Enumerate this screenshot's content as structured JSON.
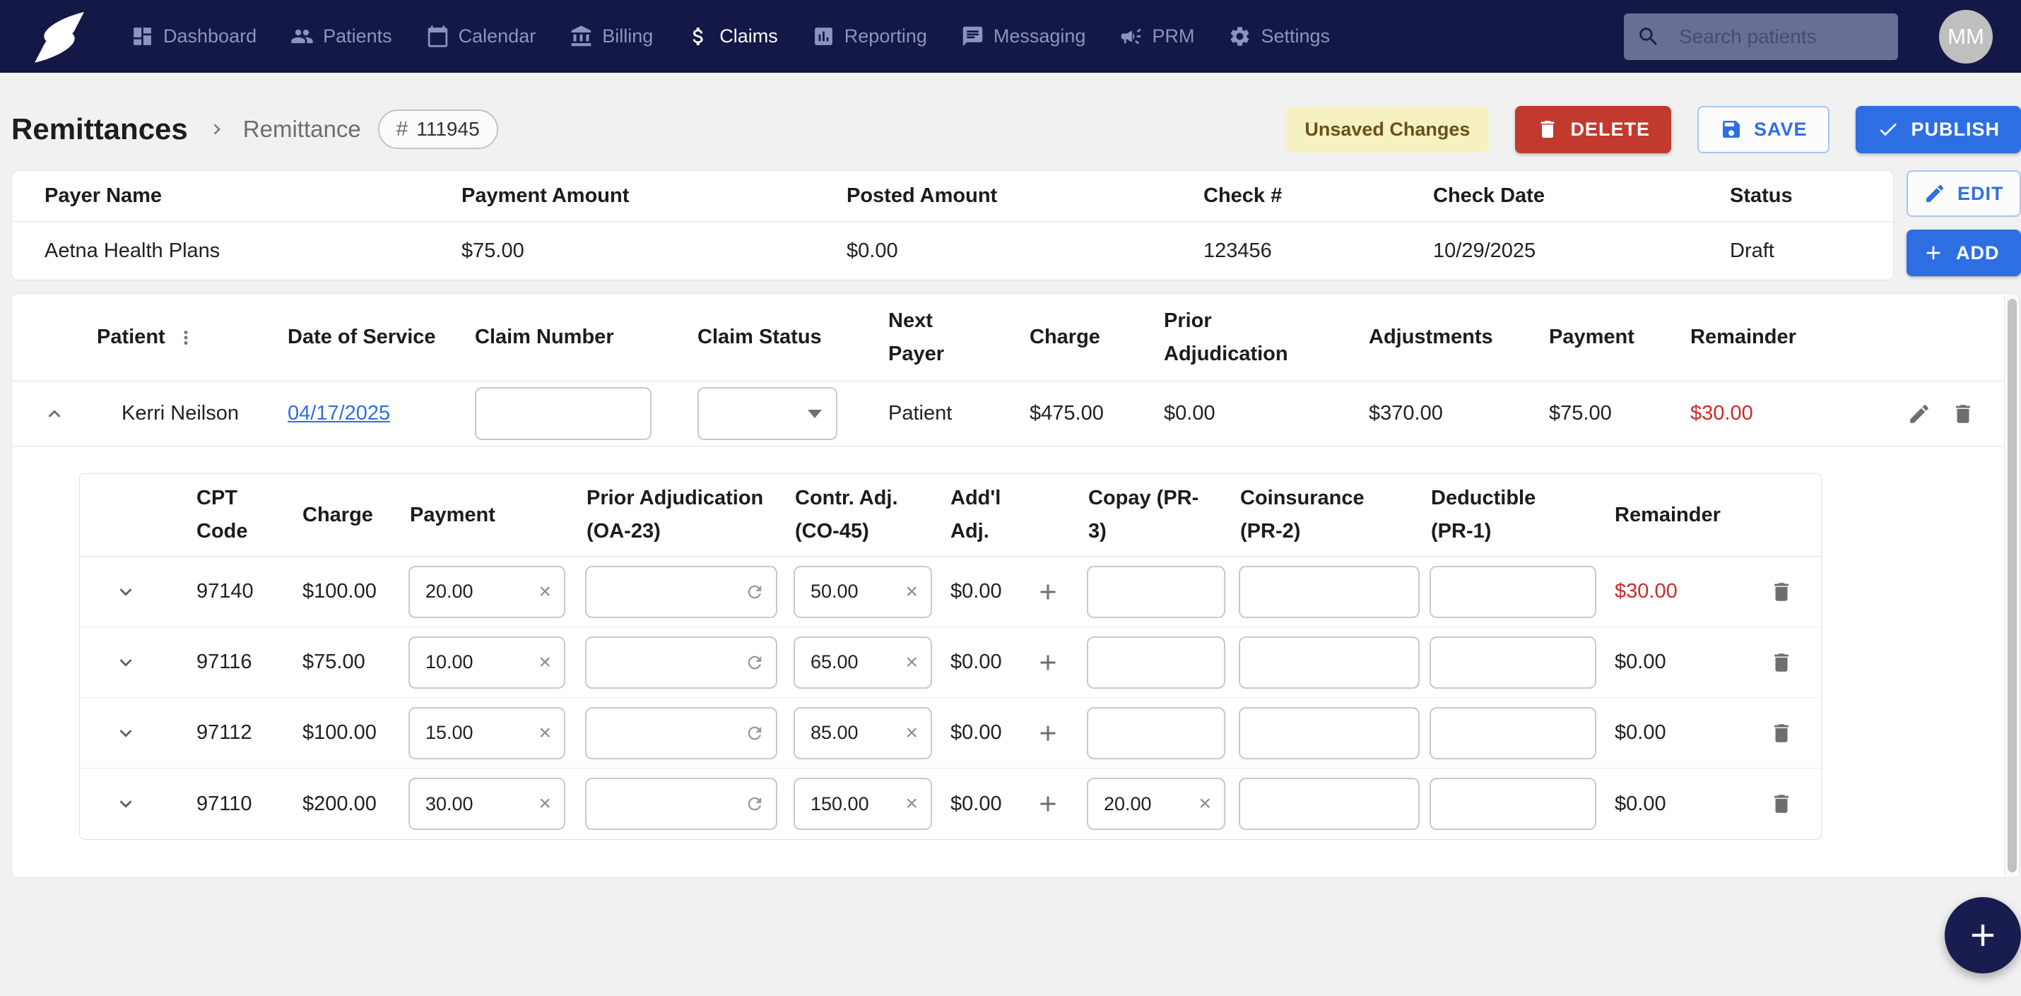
{
  "colors": {
    "nav_bg": "#141847",
    "accent_blue": "#2D6FE3",
    "danger_red": "#C13A2D",
    "warning_bg": "#F6F1C1",
    "warning_text": "#6C501C",
    "negative_red": "#CB2B2B",
    "link_blue": "#2D6FE3",
    "page_bg": "#F1F1F1"
  },
  "nav": {
    "items": [
      {
        "id": "dashboard",
        "label": "Dashboard",
        "icon": "dashboard",
        "active": false
      },
      {
        "id": "patients",
        "label": "Patients",
        "icon": "people",
        "active": false
      },
      {
        "id": "calendar",
        "label": "Calendar",
        "icon": "calendar",
        "active": false
      },
      {
        "id": "billing",
        "label": "Billing",
        "icon": "bank",
        "active": false
      },
      {
        "id": "claims",
        "label": "Claims",
        "icon": "dollar",
        "active": true
      },
      {
        "id": "reporting",
        "label": "Reporting",
        "icon": "report",
        "active": false
      },
      {
        "id": "messaging",
        "label": "Messaging",
        "icon": "message",
        "active": false
      },
      {
        "id": "prm",
        "label": "PRM",
        "icon": "megaphone",
        "active": false
      },
      {
        "id": "settings",
        "label": "Settings",
        "icon": "gear",
        "active": false
      }
    ],
    "search_placeholder": "Search patients",
    "avatar_initials": "MM"
  },
  "header": {
    "breadcrumb_root": "Remittances",
    "breadcrumb_current": "Remittance",
    "remittance_number": "111945",
    "unsaved_badge": "Unsaved Changes",
    "delete_label": "DELETE",
    "save_label": "SAVE",
    "publish_label": "PUBLISH"
  },
  "payer": {
    "columns": [
      "Payer Name",
      "Payment Amount",
      "Posted Amount",
      "Check #",
      "Check Date",
      "Status"
    ],
    "values": [
      "Aetna Health Plans",
      "$75.00",
      "$0.00",
      "123456",
      "10/29/2025",
      "Draft"
    ],
    "edit_label": "EDIT",
    "add_label": "ADD"
  },
  "claim": {
    "columns": [
      "Patient",
      "Date of Service",
      "Claim Number",
      "Claim Status",
      "Next\nPayer",
      "Charge",
      "Prior\nAdjudication",
      "Adjustments",
      "Payment",
      "Remainder"
    ],
    "row": {
      "patient": "Kerri Neilson",
      "date_of_service": "04/17/2025",
      "claim_number": "",
      "claim_status": "",
      "next_payer": "Patient",
      "charge": "$475.00",
      "prior_adjudication": "$0.00",
      "adjustments": "$370.00",
      "payment": "$75.00",
      "remainder": "$30.00",
      "remainder_negative": true
    }
  },
  "cpt_table": {
    "columns": [
      "CPT\nCode",
      "Charge",
      "Payment",
      "Prior Adjudication\n(OA-23)",
      "Contr. Adj.\n(CO-45)",
      "Add'l\nAdj.",
      "Copay (PR-\n3)",
      "Coinsurance\n(PR-2)",
      "Deductible\n(PR-1)",
      "Remainder"
    ],
    "rows": [
      {
        "code": "97140",
        "charge": "$100.00",
        "payment": "20.00",
        "prior": "",
        "contr": "50.00",
        "addl": "$0.00",
        "copay": "",
        "coinsurance": "",
        "deductible": "",
        "remainder": "$30.00",
        "remainder_negative": true
      },
      {
        "code": "97116",
        "charge": "$75.00",
        "payment": "10.00",
        "prior": "",
        "contr": "65.00",
        "addl": "$0.00",
        "copay": "",
        "coinsurance": "",
        "deductible": "",
        "remainder": "$0.00",
        "remainder_negative": false
      },
      {
        "code": "97112",
        "charge": "$100.00",
        "payment": "15.00",
        "prior": "",
        "contr": "85.00",
        "addl": "$0.00",
        "copay": "",
        "coinsurance": "",
        "deductible": "",
        "remainder": "$0.00",
        "remainder_negative": false
      },
      {
        "code": "97110",
        "charge": "$200.00",
        "payment": "30.00",
        "prior": "",
        "contr": "150.00",
        "addl": "$0.00",
        "copay": "20.00",
        "coinsurance": "",
        "deductible": "",
        "remainder": "$0.00",
        "remainder_negative": false
      }
    ]
  }
}
